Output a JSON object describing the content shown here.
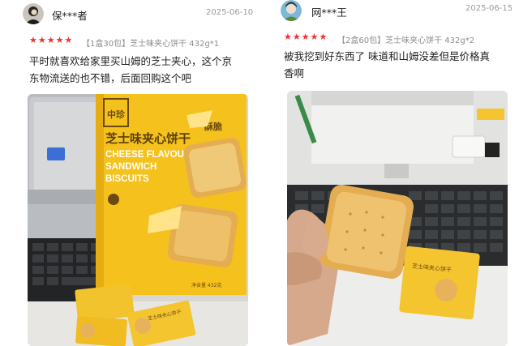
{
  "reviews": [
    {
      "username": "保***者",
      "date": "2025-06-10",
      "rating": 5,
      "spec": "【1盒30包】芝士味夹心饼干 432g*1",
      "text_line1": "平时就喜欢给家里买山姆的芝士夹心，这个京",
      "text_line2": "东物流送的也不错，后面回购这个吧",
      "photo": {
        "brand_mark": "中珍",
        "tag": "酥脆",
        "product_cn": "芝士味夹心饼干",
        "product_en_1": "CHEESE FLAVOUR",
        "product_en_2": "SANDWICH",
        "product_en_3": "BISCUITS",
        "net_weight": "净含量 432克",
        "wrapper_text": "芝士味夹心饼干"
      }
    },
    {
      "username": "网***王",
      "date": "2025-06-15",
      "rating": 5,
      "spec": "【2盒60包】芝士味夹心饼干 432g*2",
      "text_line1": "被我挖到好东西了 味道和山姆没差但是价格真",
      "text_line2": "香啊",
      "photo": {
        "wrapper_text": "芝士味夹心饼干"
      }
    }
  ],
  "colors": {
    "star": "#f0312d",
    "box_yellow": "#f5c11c",
    "biscuit": "#e4ad52"
  }
}
